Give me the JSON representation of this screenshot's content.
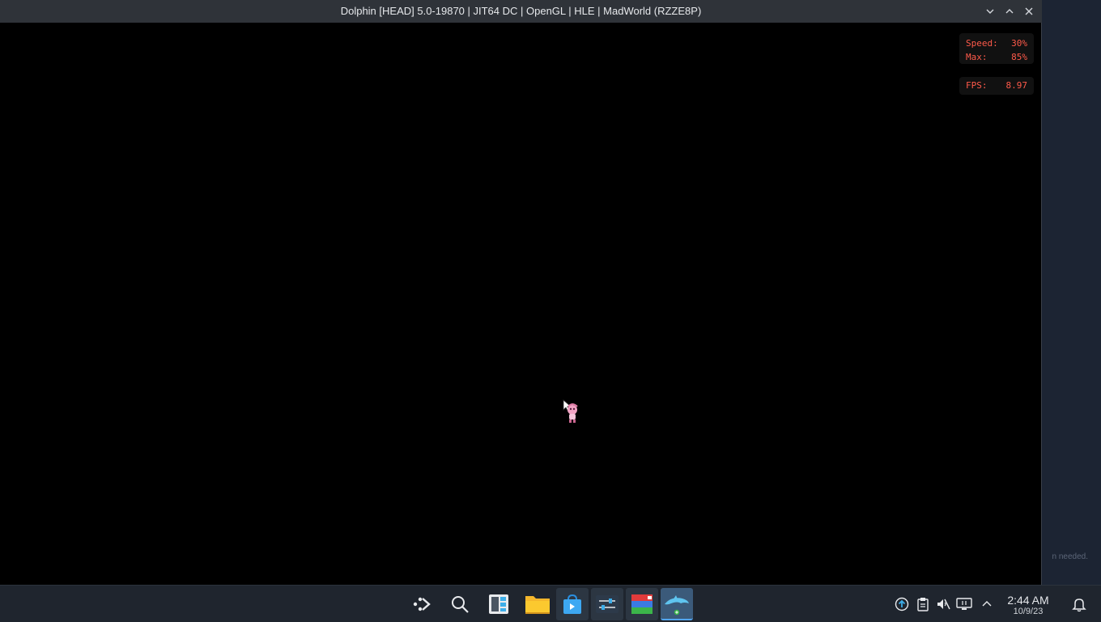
{
  "window": {
    "title": "Dolphin [HEAD] 5.0-19870 | JIT64 DC | OpenGL | HLE | MadWorld (RZZE8P)"
  },
  "osd": {
    "speed_label": "Speed:",
    "speed_value": "30%",
    "max_label": "Max:",
    "max_value": "85%",
    "fps_label": "FPS:",
    "fps_value": "8.97"
  },
  "background": {
    "partial_text": "n needed."
  },
  "taskbar": {
    "items": [
      {
        "icon": "app-launcher-icon"
      },
      {
        "icon": "search-icon"
      },
      {
        "icon": "virtual-desktop-pager-icon"
      },
      {
        "icon": "file-manager-icon"
      },
      {
        "icon": "discover-store-icon"
      },
      {
        "icon": "system-settings-icon"
      },
      {
        "icon": "emulator-frontend-icon"
      },
      {
        "icon": "dolphin-emulator-icon"
      }
    ],
    "clock": {
      "time": "2:44 AM",
      "date": "10/9/23"
    }
  },
  "colors": {
    "osd_text": "#ff5a4a",
    "titlebar": "#2f3339",
    "taskbar": "#1f252e",
    "accent": "#52a6f0"
  }
}
